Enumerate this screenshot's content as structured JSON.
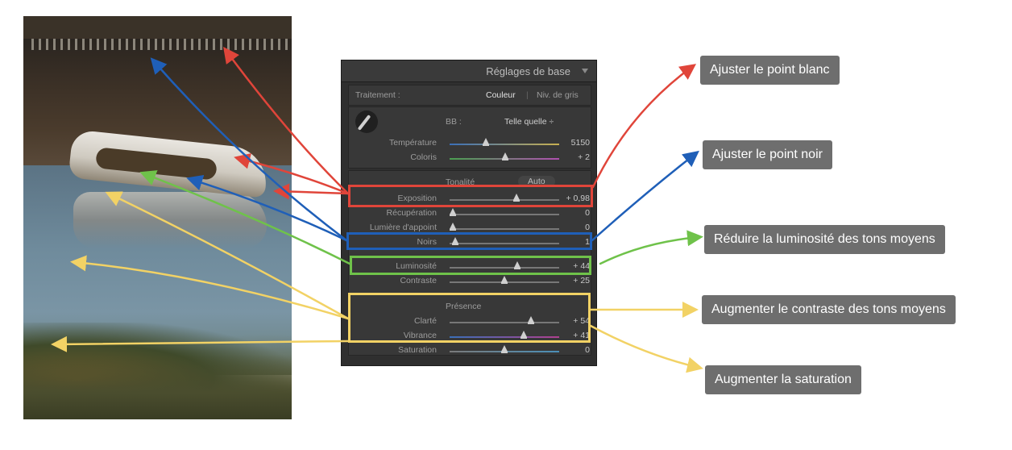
{
  "panel": {
    "title": "Réglages de base",
    "treatment": {
      "label": "Traitement :",
      "color": "Couleur",
      "grayscale": "Niv. de gris"
    },
    "wb": {
      "label": "BB :",
      "value": "Telle quelle ÷"
    },
    "tone": {
      "label": "Tonalité",
      "auto": "Auto"
    },
    "presence": {
      "label": "Présence"
    },
    "sliders": [
      {
        "label": "Température",
        "value": "5150",
        "pos": 0.33
      },
      {
        "label": "Coloris",
        "value": "+ 2",
        "pos": 0.51
      },
      {
        "label": "Exposition",
        "value": "+ 0,98",
        "pos": 0.61
      },
      {
        "label": "Récupération",
        "value": "0",
        "pos": 0.03
      },
      {
        "label": "Lumière d'appoint",
        "value": "0",
        "pos": 0.03
      },
      {
        "label": "Noirs",
        "value": "1",
        "pos": 0.05
      },
      {
        "label": "Luminosité",
        "value": "+ 44",
        "pos": 0.62
      },
      {
        "label": "Contraste",
        "value": "+ 25",
        "pos": 0.5
      },
      {
        "label": "Clarté",
        "value": "+ 54",
        "pos": 0.74
      },
      {
        "label": "Vibrance",
        "value": "+ 41",
        "pos": 0.68
      },
      {
        "label": "Saturation",
        "value": "0",
        "pos": 0.5
      }
    ]
  },
  "callouts": {
    "white": "Ajuster le point blanc",
    "black": "Ajuster le point noir",
    "midlum": "Réduire la luminosité des tons moyens",
    "midcontrast": "Augmenter le contraste des tons moyens",
    "saturation": "Augmenter la saturation"
  },
  "colors": {
    "red": "#e0453a",
    "blue": "#1f5fb8",
    "green": "#6fc24a",
    "yellow": "#f2d265",
    "callout_bg": "#6e6e6e"
  },
  "icons": {
    "dropper": "eyedropper-icon",
    "collapse": "triangle-down-icon"
  }
}
